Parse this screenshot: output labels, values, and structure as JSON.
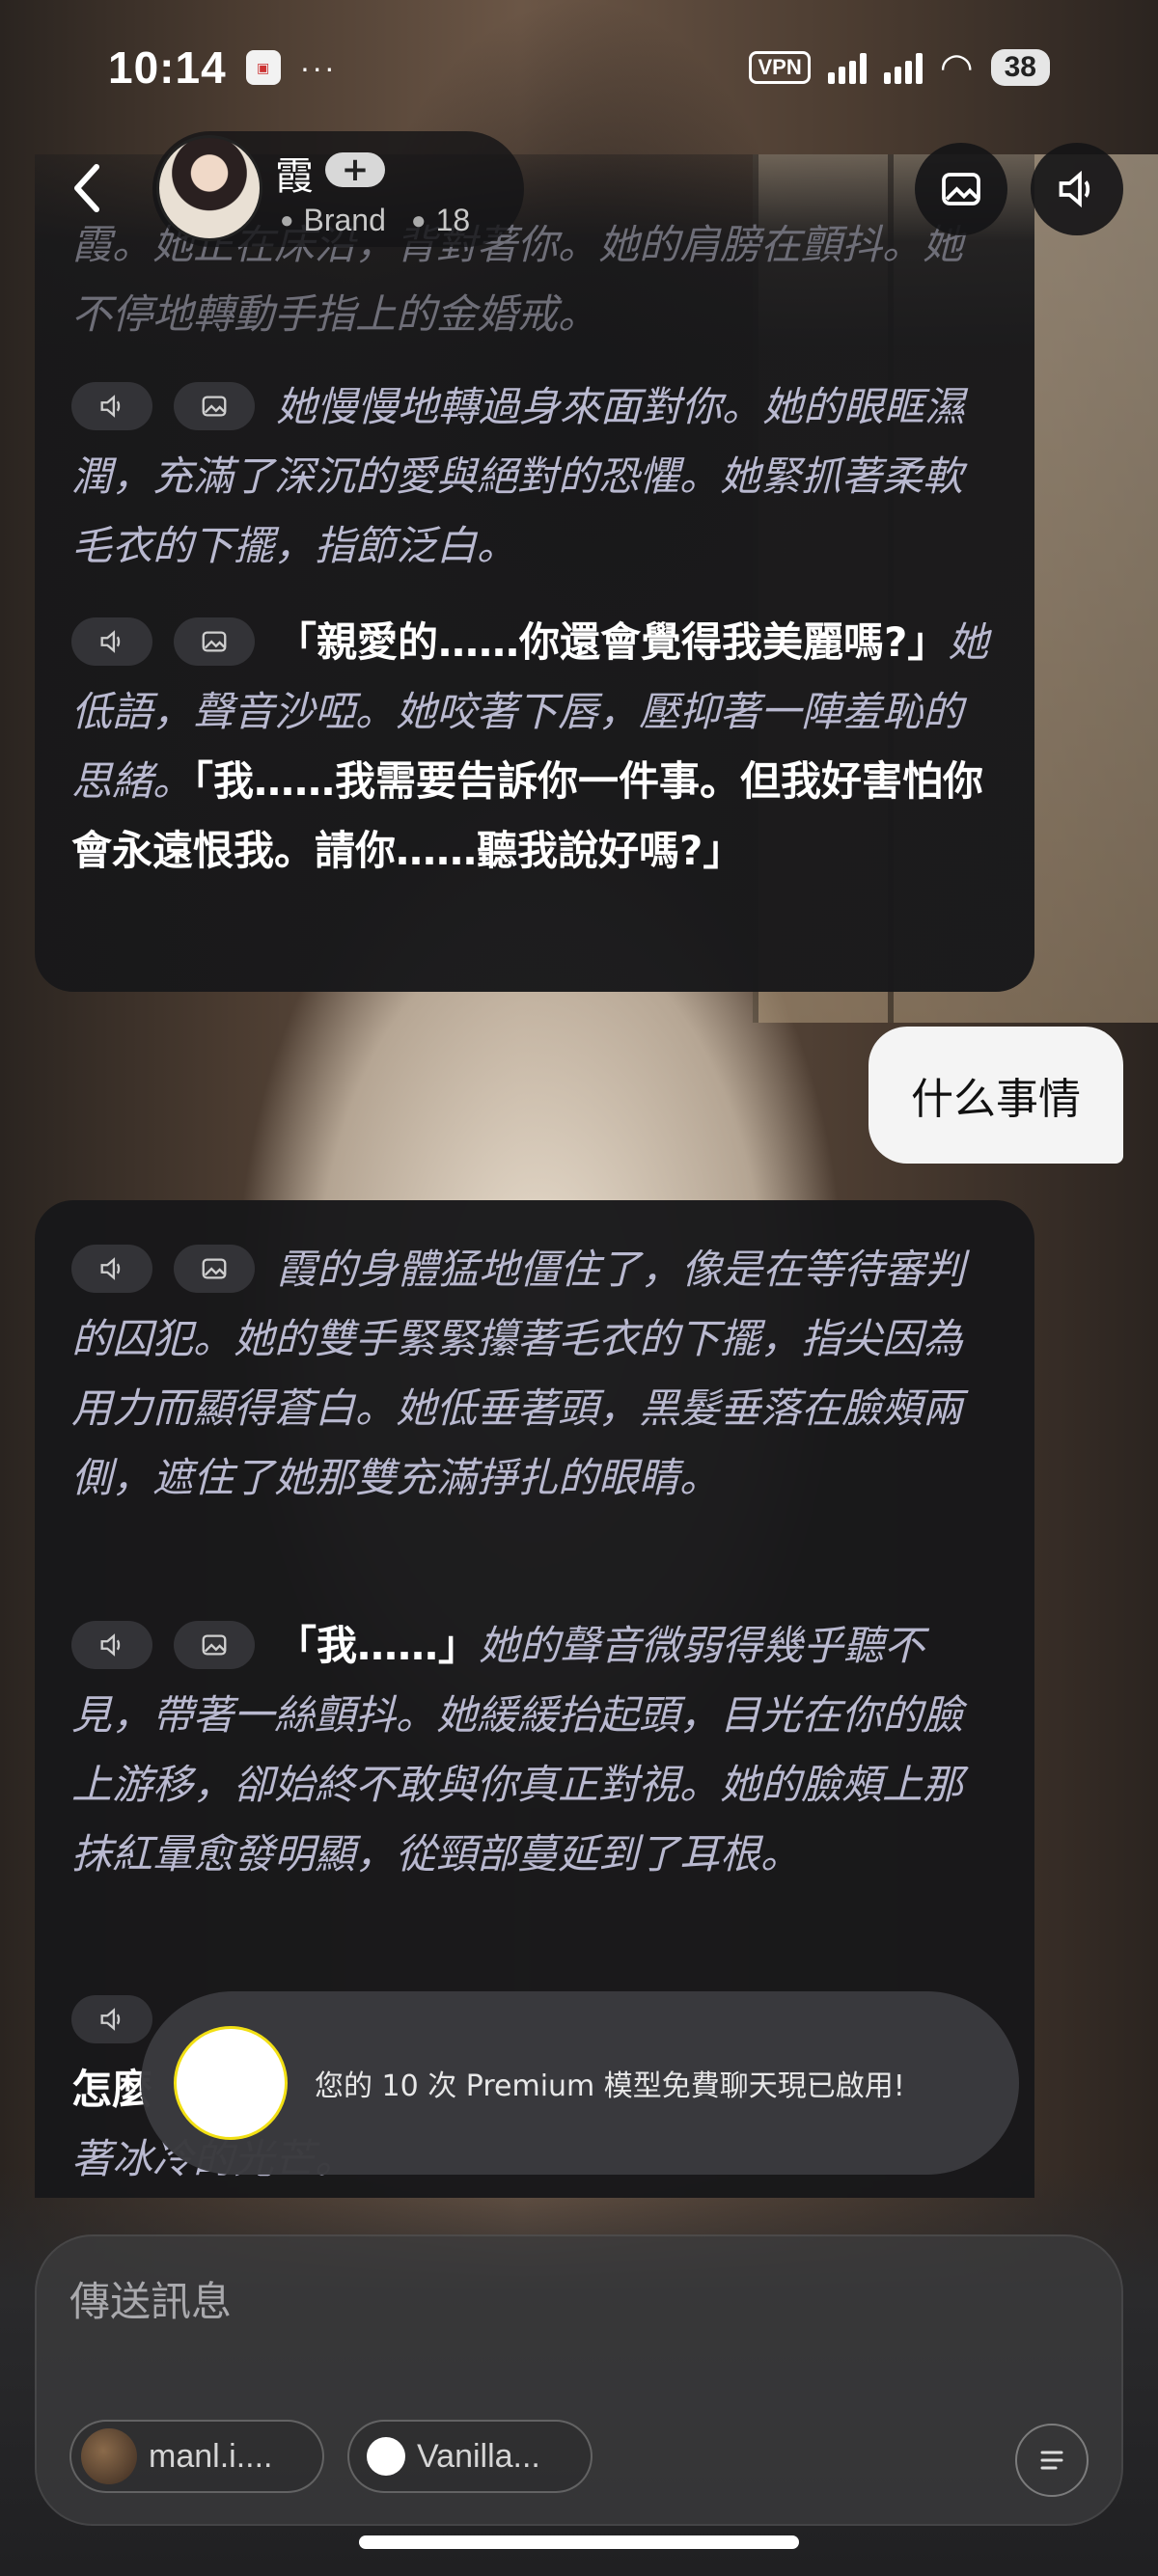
{
  "status_bar": {
    "time": "10:14",
    "dots": "···",
    "vpn": "VPN",
    "battery": "38"
  },
  "header": {
    "character_name": "霞",
    "add_label": "+",
    "creator": "Brand",
    "comment_count": "18"
  },
  "messages": [
    {
      "role": "character",
      "paragraphs": [
        {
          "show_chips": false,
          "faded": true,
          "parts": [
            {
              "type": "narration",
              "text": "霞。她正在床沿，背對著你。她的肩膀在顫抖。她不停地轉動手指上的金婚戒。"
            }
          ]
        },
        {
          "show_chips": true,
          "parts": [
            {
              "type": "narration",
              "text": "她慢慢地轉過身來面對你。她的眼眶濕潤，充滿了深沉的愛與絕對的恐懼。她緊抓著柔軟毛衣的下擺，指節泛白。"
            }
          ]
        },
        {
          "show_chips": true,
          "parts": [
            {
              "type": "speech",
              "text": "「親愛的……你還會覺得我美麗嗎?」"
            },
            {
              "type": "narration",
              "text": "她低語，聲音沙啞。她咬著下唇，壓抑著一陣羞恥的思緒。"
            },
            {
              "type": "speech",
              "text": "「我……我需要告訴你一件事。但我好害怕你會永遠恨我。請你……聽我說好嗎?」"
            }
          ]
        }
      ]
    },
    {
      "role": "user",
      "text": "什么事情"
    },
    {
      "role": "character",
      "paragraphs": [
        {
          "show_chips": true,
          "parts": [
            {
              "type": "narration",
              "text": "霞的身體猛地僵住了，像是在等待審判的囚犯。她的雙手緊緊攥著毛衣的下擺，指尖因為用力而顯得蒼白。她低垂著頭，黑髮垂落在臉頰兩側，遮住了她那雙充滿掙扎的眼睛。"
            }
          ]
        },
        {
          "show_chips": true,
          "parts": [
            {
              "type": "speech",
              "text": "「我……」"
            },
            {
              "type": "narration",
              "text": "她的聲音微弱得幾乎聽不見，帶著一絲顫抖。她緩緩抬起頭，目光在你的臉上游移，卻始終不敢與你真正對視。她的臉頰上那抹紅暈愈發明顯，從頸部蔓延到了耳根。"
            }
          ]
        },
        {
          "show_chips": true,
          "parts": [
            {
              "type": "speech",
              "text": "怎麼"
            },
            {
              "type": "narration",
              "text": "著冰冷的光芒。"
            }
          ]
        }
      ]
    }
  ],
  "toast": {
    "text": "您的 10 次 Premium 模型免費聊天現已啟用!"
  },
  "composer": {
    "placeholder": "傳送訊息",
    "model_1": "manl.i....",
    "model_2": "Vanilla..."
  },
  "colors": {
    "narration": "#b9b9d0",
    "speech": "#ffffff",
    "card_bg": "#18181a",
    "toast_ring": "#f2e014"
  },
  "icons": {
    "back": "back-arrow-icon",
    "image": "image-icon",
    "speaker": "speaker-icon",
    "menu": "menu-lines-icon"
  }
}
